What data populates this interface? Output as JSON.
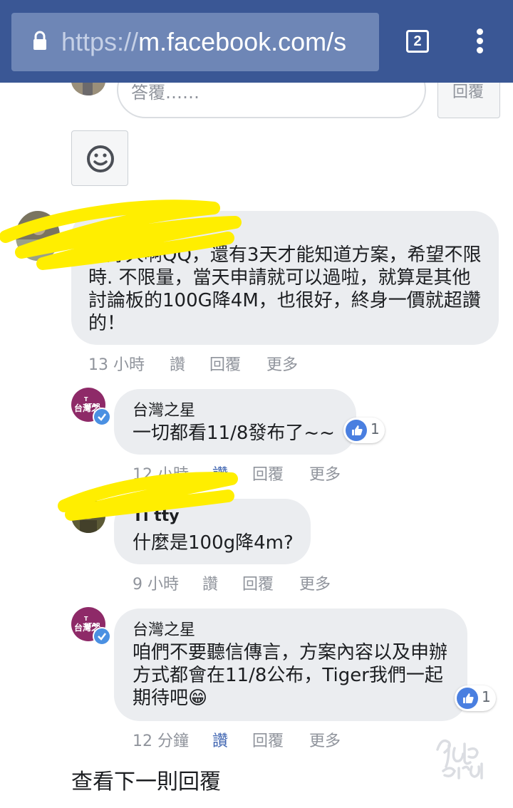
{
  "browser": {
    "url_scheme": "https://",
    "url_rest": "m.facebook.com/s",
    "tab_count": "2",
    "lock_icon": "lock-icon",
    "menu_icon": "more-vert-icon"
  },
  "reply": {
    "placeholder": "答覆……",
    "submit_label": "回覆",
    "emoji_icon": "smiley-icon"
  },
  "comments": [
    {
      "author": "",
      "text": "等好久啊QQ，還有3天才能知道方案，希望不限時. 不限量，當天申請就可以過啦，就算是其他討論板的100G降4M，也很好，終身一價就超讚的！",
      "time": "13 小時",
      "like": "讚",
      "reply": "回覆",
      "more": "更多"
    },
    {
      "author": "台灣之星",
      "avatar_text_top": "T STAR",
      "avatar_text": "台灣之",
      "text": "一切都看11/8發布了~~",
      "reactions": "1",
      "time": "12 小時",
      "like": "讚",
      "reply": "回覆",
      "more": "更多"
    },
    {
      "author": "Ti      tty",
      "text": "什麼是100g降4m?",
      "time": "9 小時",
      "like": "讚",
      "reply": "回覆",
      "more": "更多"
    },
    {
      "author": "台灣之星",
      "avatar_text_top": "T STAR",
      "avatar_text": "台灣之",
      "text": "咱們不要聽信傳言，方案內容以及申辦方式都會在11/8公布，Tiger我們一起期待吧😁",
      "reactions": "1",
      "time": "12 分鐘",
      "like": "讚",
      "reply": "回覆",
      "more": "更多"
    }
  ],
  "view_next": "查看下一則回覆",
  "colors": {
    "chrome": "#3a5795",
    "bubble": "#ebedf0",
    "link_blue": "#4267b2",
    "scribble": "#ffee00",
    "tstar": "#8e2a68"
  }
}
